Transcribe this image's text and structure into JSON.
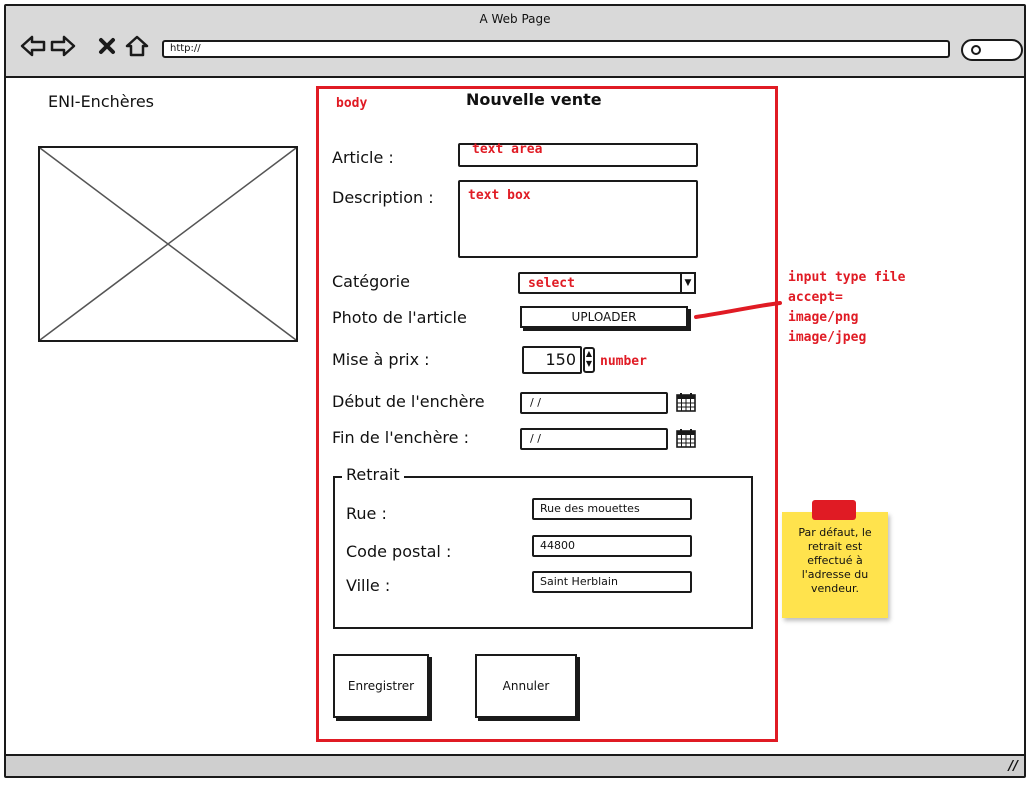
{
  "window": {
    "title": "A Web Page",
    "address": "http://",
    "icons": [
      "back-arrow-icon",
      "forward-arrow-icon",
      "close-icon",
      "home-icon",
      "search-icon"
    ]
  },
  "sidebar": {
    "brand": "ENI-Enchères",
    "logo": "image-placeholder-icon"
  },
  "form": {
    "body_annotation": "body",
    "title": "Nouvelle vente",
    "article_label": "Article :",
    "article_annotation": "text area",
    "description_label": "Description :",
    "description_annotation": "text box",
    "category_label": "Catégorie",
    "category_annotation": "select",
    "photo_label": "Photo de l'article",
    "uploader_label": "UPLOADER",
    "price_label": "Mise à prix :",
    "price_value": "150",
    "price_annotation": "number",
    "start_label": "Début de l'enchère",
    "start_value": "/ /",
    "end_label": "Fin de l'enchère :",
    "end_value": "/ /",
    "withdrawal": {
      "legend": "Retrait",
      "street_label": "Rue :",
      "street_value": "Rue des mouettes",
      "postal_label": "Code postal :",
      "postal_value": "44800",
      "city_label": "Ville :",
      "city_value": "Saint Herblain"
    },
    "save_label": "Enregistrer",
    "cancel_label": "Annuler"
  },
  "annotations": {
    "file_input_line1": "input type file",
    "file_input_line2": "accept=",
    "file_input_line3": "image/png",
    "file_input_line4": "image/jpeg",
    "sticky_note": "Par défaut, le retrait est effectué à l'adresse du vendeur."
  },
  "colors": {
    "annotation_red": "#e01b24",
    "sticky_yellow": "#ffe34d",
    "chrome_gray": "#d9d9d9"
  }
}
